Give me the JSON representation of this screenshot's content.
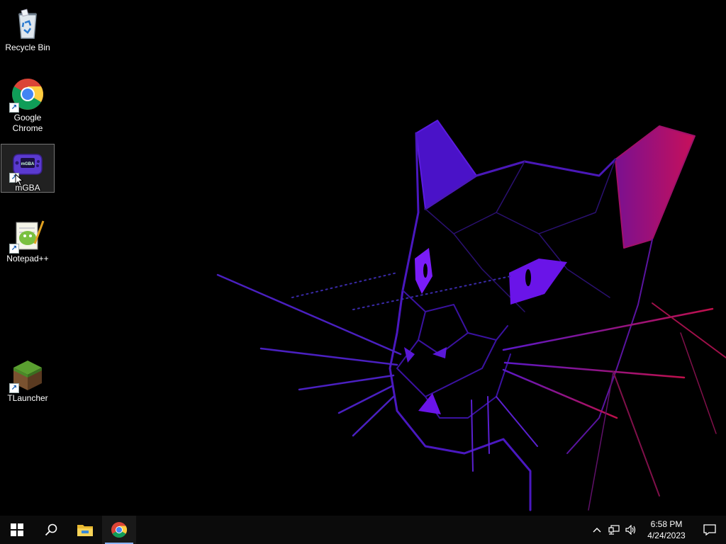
{
  "desktop": {
    "icons": [
      {
        "label": "Recycle Bin",
        "icon": "recycle-bin-icon",
        "shortcut": false
      },
      {
        "label": "Google\nChrome",
        "icon": "chrome-icon",
        "shortcut": true
      },
      {
        "label": "mGBA",
        "icon": "mgba-icon",
        "shortcut": true,
        "selected": true
      },
      {
        "label": "Notepad++",
        "icon": "notepad-plus-plus-icon",
        "shortcut": true
      },
      {
        "label": "TLauncher",
        "icon": "tlauncher-icon",
        "shortcut": true
      }
    ],
    "wallpaper": "purple-neon-panther"
  },
  "taskbar": {
    "start": {
      "icon": "windows-start-icon"
    },
    "search": {
      "icon": "search-icon"
    },
    "apps": [
      {
        "name": "File Explorer",
        "icon": "file-explorer-icon",
        "active": false
      },
      {
        "name": "Google Chrome",
        "icon": "chrome-icon",
        "active": true
      }
    ],
    "tray": {
      "icons": [
        "chevron-up-icon",
        "network-icon",
        "volume-icon"
      ],
      "time": "6:58 PM",
      "date": "4/24/2023"
    },
    "notifications": {
      "icon": "action-center-icon"
    }
  },
  "colors": {
    "accent": "#8ab4f8",
    "taskbar": "#0b0b0b",
    "wallpaper_purple": "#6a14f0",
    "wallpaper_magenta": "#c0105a"
  }
}
